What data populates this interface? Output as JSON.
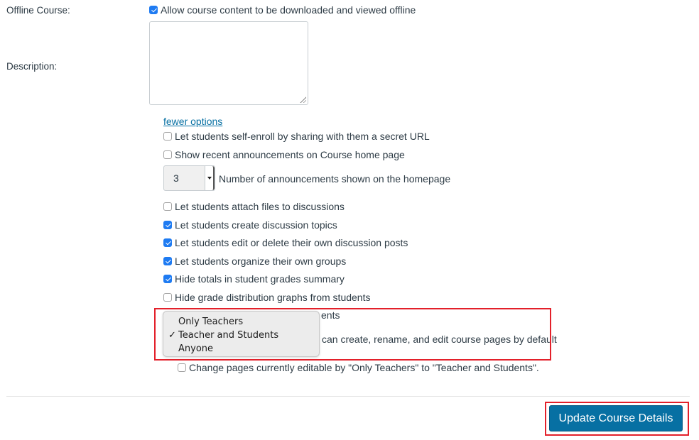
{
  "offline_course": {
    "label": "Offline Course:",
    "checkbox_label": "Allow course content to be downloaded and viewed offline",
    "checked": true
  },
  "description": {
    "label": "Description:",
    "value": ""
  },
  "fewer_options_link": "fewer options",
  "options": [
    {
      "label": "Let students self-enroll by sharing with them a secret URL",
      "checked": false
    },
    {
      "label": "Show recent announcements on Course home page",
      "checked": false
    }
  ],
  "announcements_select": {
    "value": "3",
    "label": "Number of announcements shown on the homepage"
  },
  "options2": [
    {
      "label": "Let students attach files to discussions",
      "checked": false
    },
    {
      "label": "Let students create discussion topics",
      "checked": true
    },
    {
      "label": "Let students edit or delete their own discussion posts",
      "checked": true
    },
    {
      "label": "Let students organize their own groups",
      "checked": true
    },
    {
      "label": "Hide totals in student grades summary",
      "checked": true
    },
    {
      "label": "Hide grade distribution graphs from students",
      "checked": false
    }
  ],
  "partially_hidden": {
    "row1_visible_text": "ents",
    "row2_visible_text": "can create, rename, and edit course pages by default"
  },
  "page_edit_dropdown": {
    "options": [
      "Only Teachers",
      "Teacher and Students",
      "Anyone"
    ],
    "selected": "Teacher and Students",
    "check_glyph": "✓"
  },
  "change_pages": {
    "label": "Change pages currently editable by \"Only Teachers\" to \"Teacher and Students\".",
    "checked": false
  },
  "submit_button": "Update Course Details",
  "colors": {
    "link": "#0770a3",
    "button": "#0770a3",
    "checkbox_checked": "#1e7bf2",
    "highlight": "#e3202a"
  }
}
